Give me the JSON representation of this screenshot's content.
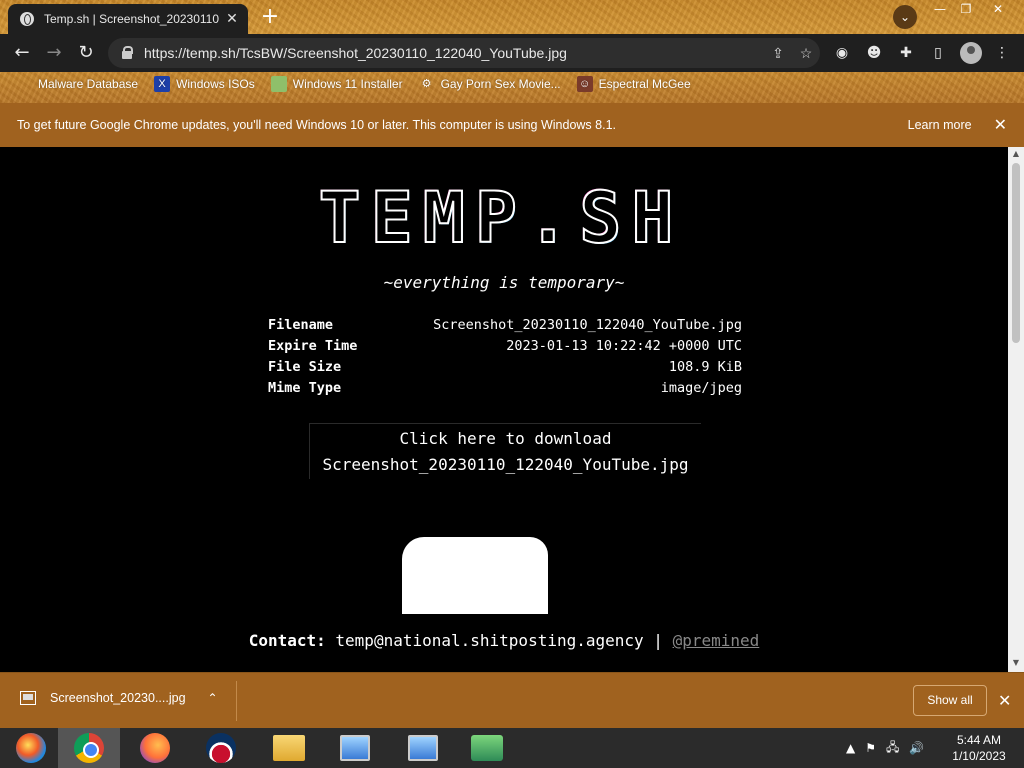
{
  "browser": {
    "tab_title": "Temp.sh | Screenshot_20230110",
    "tab_close": "✕",
    "new_tab": "+",
    "url": "https://temp.sh/TcsBW/Screenshot_20230110_122040_YouTube.jpg",
    "bookmarks": [
      {
        "label": "Malware Database",
        "icon": "bookmark-blank-icon"
      },
      {
        "label": "Windows ISOs",
        "icon": "x-logo-icon"
      },
      {
        "label": "Windows 11 Installer",
        "icon": "image-icon"
      },
      {
        "label": "Gay Porn Sex Movie...",
        "icon": "gear-icon"
      },
      {
        "label": "Espectral McGee",
        "icon": "character-icon"
      }
    ]
  },
  "infobar": {
    "message": "To get future Google Chrome updates, you'll need Windows 10 or later. This computer is using Windows 8.1.",
    "learn_more": "Learn more",
    "close": "✕"
  },
  "page": {
    "logo": "TEMP.SH",
    "tagline": "~everything is temporary~",
    "info": [
      {
        "key": "Filename",
        "value": "Screenshot_20230110_122040_YouTube.jpg"
      },
      {
        "key": "Expire Time",
        "value": "2023-01-13 10:22:42 +0000 UTC"
      },
      {
        "key": "File Size",
        "value": "108.9 KiB"
      },
      {
        "key": "Mime Type",
        "value": "image/jpeg"
      }
    ],
    "download_line1": "Click here to download",
    "download_line2": "Screenshot_20230110_122040_YouTube.jpg",
    "contact_label": "Contact:",
    "contact_email": "temp@national.shitposting.agency",
    "contact_sep": "|",
    "contact_handle": "@premined"
  },
  "download_shelf": {
    "file_name": "Screenshot_20230....jpg",
    "show_all": "Show all",
    "close": "✕"
  },
  "taskbar": {
    "time": "5:44 AM",
    "date": "1/10/2023"
  },
  "colors": {
    "chrome_frame": "#c98a2b",
    "infobar_bg": "#a0621f",
    "page_bg": "#000000",
    "taskbar_bg": "#2b2b2b"
  }
}
